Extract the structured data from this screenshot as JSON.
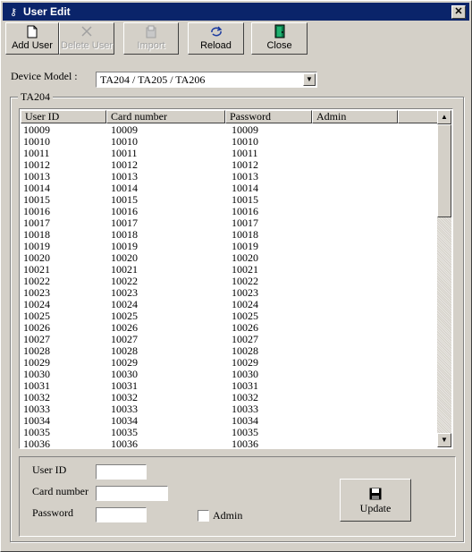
{
  "window": {
    "title": "User Edit"
  },
  "toolbar": [
    {
      "label": "Add User",
      "icon": "new-document-icon",
      "enabled": true
    },
    {
      "label": "Delete User",
      "icon": "delete-x-icon",
      "enabled": false
    },
    {
      "label": "Import",
      "icon": "import-icon",
      "enabled": false
    },
    {
      "label": "Reload",
      "icon": "reload-icon",
      "enabled": true
    },
    {
      "label": "Close",
      "icon": "door-exit-icon",
      "enabled": true
    }
  ],
  "device": {
    "label": "Device Model :",
    "selected": "TA204 / TA205 / TA206"
  },
  "group": {
    "label": "TA204"
  },
  "table": {
    "columns": [
      "User ID",
      "Card number",
      "Password",
      "Admin"
    ],
    "rows": [
      [
        "10009",
        "10009",
        "10009",
        ""
      ],
      [
        "10010",
        "10010",
        "10010",
        ""
      ],
      [
        "10011",
        "10011",
        "10011",
        ""
      ],
      [
        "10012",
        "10012",
        "10012",
        ""
      ],
      [
        "10013",
        "10013",
        "10013",
        ""
      ],
      [
        "10014",
        "10014",
        "10014",
        ""
      ],
      [
        "10015",
        "10015",
        "10015",
        ""
      ],
      [
        "10016",
        "10016",
        "10016",
        ""
      ],
      [
        "10017",
        "10017",
        "10017",
        ""
      ],
      [
        "10018",
        "10018",
        "10018",
        ""
      ],
      [
        "10019",
        "10019",
        "10019",
        ""
      ],
      [
        "10020",
        "10020",
        "10020",
        ""
      ],
      [
        "10021",
        "10021",
        "10021",
        ""
      ],
      [
        "10022",
        "10022",
        "10022",
        ""
      ],
      [
        "10023",
        "10023",
        "10023",
        ""
      ],
      [
        "10024",
        "10024",
        "10024",
        ""
      ],
      [
        "10025",
        "10025",
        "10025",
        ""
      ],
      [
        "10026",
        "10026",
        "10026",
        ""
      ],
      [
        "10027",
        "10027",
        "10027",
        ""
      ],
      [
        "10028",
        "10028",
        "10028",
        ""
      ],
      [
        "10029",
        "10029",
        "10029",
        ""
      ],
      [
        "10030",
        "10030",
        "10030",
        ""
      ],
      [
        "10031",
        "10031",
        "10031",
        ""
      ],
      [
        "10032",
        "10032",
        "10032",
        ""
      ],
      [
        "10033",
        "10033",
        "10033",
        ""
      ],
      [
        "10034",
        "10034",
        "10034",
        ""
      ],
      [
        "10035",
        "10035",
        "10035",
        ""
      ],
      [
        "10036",
        "10036",
        "10036",
        ""
      ]
    ]
  },
  "form": {
    "user_id_label": "User ID",
    "user_id_value": "",
    "card_number_label": "Card number",
    "card_number_value": "",
    "password_label": "Password",
    "password_value": "",
    "admin_label": "Admin",
    "admin_checked": false,
    "update_label": "Update"
  }
}
